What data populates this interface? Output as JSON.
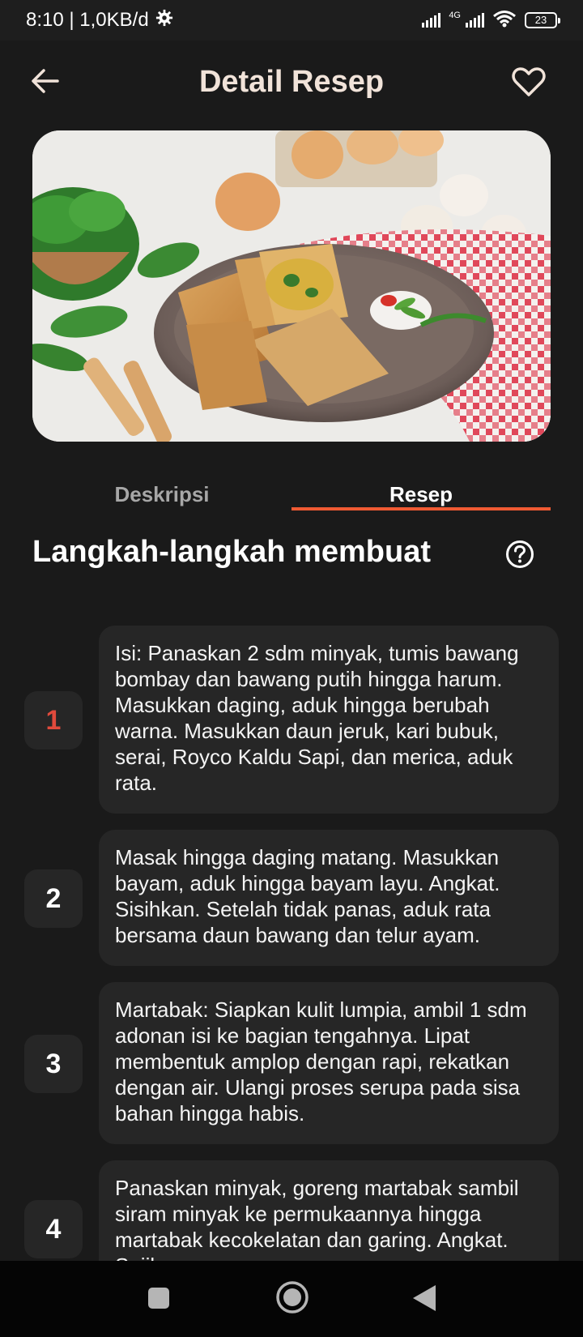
{
  "status_bar": {
    "time_info": "8:10 | 1,0KB/d",
    "network_type": "4G",
    "battery_level": "23",
    "icons": [
      "gear-icon",
      "signal-icon",
      "wifi-icon",
      "battery-icon"
    ]
  },
  "header": {
    "title": "Detail Resep",
    "back_icon": "arrow-left-icon",
    "favorite_icon": "heart-outline-icon"
  },
  "hero": {
    "image_subject": "martabak-photo"
  },
  "tabs": [
    {
      "label": "Deskripsi",
      "active": false
    },
    {
      "label": "Resep",
      "active": true
    }
  ],
  "section": {
    "title": "Langkah-langkah membuat",
    "help_icon": "question-circle-icon"
  },
  "steps": [
    {
      "number": "1",
      "text": "Isi: Panaskan 2 sdm minyak, tumis bawang bombay dan bawang putih hingga harum. Masukkan daging, aduk hingga berubah warna. Masukkan daun jeruk, kari bubuk, serai, Royco Kaldu Sapi, dan merica, aduk rata."
    },
    {
      "number": "2",
      "text": "Masak hingga daging matang. Masukkan bayam, aduk hingga bayam layu. Angkat. Sisihkan. Setelah tidak panas, aduk rata bersama daun bawang dan telur ayam."
    },
    {
      "number": "3",
      "text": "Martabak: Siapkan kulit lumpia, ambil 1 sdm adonan isi ke bagian tengahnya. Lipat membentuk amplop dengan rapi, rekatkan dengan air. Ulangi proses serupa pada sisa bahan hingga habis."
    },
    {
      "number": "4",
      "text": "Panaskan minyak, goreng martabak sambil siram minyak ke permukaannya hingga martabak kecokelatan dan garing. Angkat. Sajikan."
    }
  ],
  "colors": {
    "background": "#1a1a1a",
    "card": "#262626",
    "accent": "#ef5a33",
    "step_one_number": "#e04a3c",
    "title": "#f1e3d9"
  },
  "nav_bar": {
    "icons": [
      "square-recents-icon",
      "circle-home-icon",
      "triangle-back-icon"
    ]
  }
}
